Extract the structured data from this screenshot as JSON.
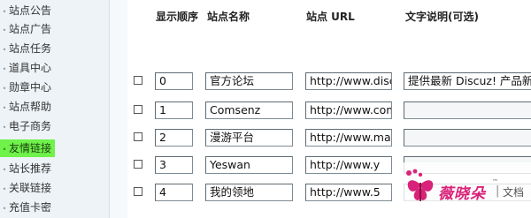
{
  "sidebar": {
    "items": [
      {
        "label": "站点公告",
        "active": false
      },
      {
        "label": "站点广告",
        "active": false
      },
      {
        "label": "站点任务",
        "active": false
      },
      {
        "label": "道具中心",
        "active": false
      },
      {
        "label": "勋章中心",
        "active": false
      },
      {
        "label": "站点帮助",
        "active": false
      },
      {
        "label": "电子商务",
        "active": false
      },
      {
        "label": "友情链接",
        "active": true
      },
      {
        "label": "站长推荐",
        "active": false
      },
      {
        "label": "关联链接",
        "active": false
      },
      {
        "label": "充值卡密",
        "active": false
      }
    ],
    "active_color": "#6ff24a"
  },
  "table": {
    "headers": {
      "order": "显示顺序",
      "name": "站点名称",
      "url": "站点 URL",
      "desc": "文字说明(可选)"
    },
    "rows": [
      {
        "checked": false,
        "order": "0",
        "name": "官方论坛",
        "url": "http://www.discuz",
        "desc": "提供最新 Discuz! 产品新闻、"
      },
      {
        "checked": false,
        "order": "1",
        "name": "Comsenz",
        "url": "http://www.com",
        "desc": ""
      },
      {
        "checked": false,
        "order": "2",
        "name": "漫游平台",
        "url": "http://www.man",
        "desc": ""
      },
      {
        "checked": false,
        "order": "3",
        "name": "Yeswan",
        "url": "http://www.y",
        "desc": ""
      },
      {
        "checked": false,
        "order": "4",
        "name": "我的领地",
        "url": "http://www.5",
        "desc": ""
      }
    ]
  },
  "watermark": {
    "brand": "薇晓朵",
    "tm": "™",
    "separator": "|",
    "suffix": "文档",
    "icon": "flower-butterfly-logo-icon",
    "color": "#d9227a"
  }
}
